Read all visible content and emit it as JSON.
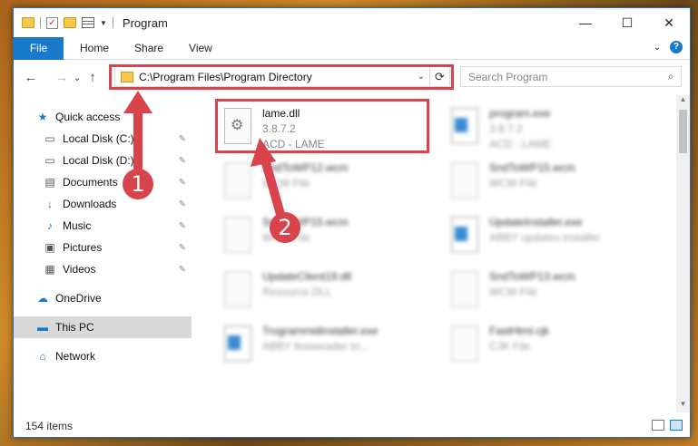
{
  "window": {
    "title": "Program",
    "controls": {
      "minimize": "—",
      "maximize": "☐",
      "close": "✕"
    }
  },
  "ribbon": {
    "tabs": [
      "File",
      "Home",
      "Share",
      "View"
    ],
    "expand_symbol": "⌄",
    "help_symbol": "?"
  },
  "address": {
    "path": "C:\\Program Files\\Program Directory",
    "dropdown_symbol": "⌄",
    "refresh_symbol": "⟳"
  },
  "search": {
    "placeholder": "Search Program",
    "icon_symbol": "⌕"
  },
  "nav": {
    "back": "←",
    "forward": "→",
    "recent": "⌄",
    "up": "↑"
  },
  "sidebar": {
    "items": [
      {
        "label": "Quick access",
        "icon": "star-icon",
        "symbol": "★",
        "color": "#1979ca",
        "pinned": false
      },
      {
        "label": "Local Disk (C:)",
        "icon": "disk-icon",
        "symbol": "▭",
        "color": "#555",
        "pinned": true
      },
      {
        "label": "Local Disk (D:)",
        "icon": "disk-icon",
        "symbol": "▭",
        "color": "#555",
        "pinned": true
      },
      {
        "label": "Documents",
        "icon": "documents-icon",
        "symbol": "▤",
        "color": "#555",
        "pinned": true
      },
      {
        "label": "Downloads",
        "icon": "downloads-icon",
        "symbol": "↓",
        "color": "#1979ca",
        "pinned": true
      },
      {
        "label": "Music",
        "icon": "music-icon",
        "symbol": "♪",
        "color": "#1979ca",
        "pinned": true
      },
      {
        "label": "Pictures",
        "icon": "pictures-icon",
        "symbol": "▣",
        "color": "#555",
        "pinned": true
      },
      {
        "label": "Videos",
        "icon": "videos-icon",
        "symbol": "▦",
        "color": "#555",
        "pinned": true
      },
      {
        "label": "OneDrive",
        "icon": "onedrive-icon",
        "symbol": "☁",
        "color": "#1979ca",
        "pinned": false
      },
      {
        "label": "This PC",
        "icon": "this-pc-icon",
        "symbol": "▬",
        "color": "#1979ca",
        "pinned": false,
        "selected": true
      },
      {
        "label": "Network",
        "icon": "network-icon",
        "symbol": "⌂",
        "color": "#1979ca",
        "pinned": false
      }
    ],
    "pin_symbol": "✎"
  },
  "files": [
    {
      "name": "lame.dll",
      "line2": "3.8.7.2",
      "line3": "ACD - LAME",
      "type": "dll",
      "blurred": false
    },
    {
      "name": "program.exe",
      "line2": "3.8.7.2",
      "line3": "ACD - LAME",
      "type": "exe",
      "blurred": true
    },
    {
      "name": "SndToWP12.wcm",
      "line2": "WCM File",
      "line3": "",
      "type": "doc",
      "blurred": true
    },
    {
      "name": "SndToWP15.wcm",
      "line2": "WCM File",
      "line3": "",
      "type": "doc",
      "blurred": true
    },
    {
      "name": "SndToWP15.wcm",
      "line2": "WCM File",
      "line3": "",
      "type": "doc",
      "blurred": true
    },
    {
      "name": "UpdateInstaller.exe",
      "line2": "ABBY updates installer",
      "line3": "",
      "type": "exe",
      "blurred": true
    },
    {
      "name": "UpdateClient19.dll",
      "line2": "Resource DLL",
      "line3": "",
      "type": "doc",
      "blurred": true
    },
    {
      "name": "SndToWP13.wcm",
      "line2": "WCM File",
      "line3": "",
      "type": "doc",
      "blurred": true
    },
    {
      "name": "Trogrammidinstaller.exe",
      "line2": "ABBY fineweader tri...",
      "line3": "",
      "type": "exe",
      "blurred": true
    },
    {
      "name": "FastHtml.cjk",
      "line2": "CJK File",
      "line3": "",
      "type": "doc",
      "blurred": true
    }
  ],
  "status": {
    "count": "154 items"
  },
  "annotations": {
    "step1": "1",
    "step2": "2",
    "color": "#d9434b"
  }
}
